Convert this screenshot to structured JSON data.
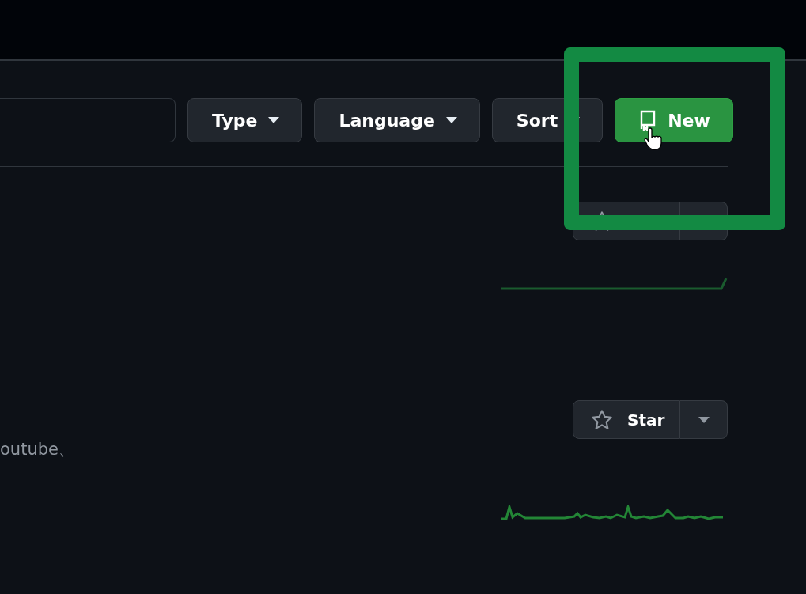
{
  "toolbar": {
    "filters": [
      {
        "label": "Type"
      },
      {
        "label": "Language"
      },
      {
        "label": "Sort"
      }
    ],
    "new_button": {
      "label": "New"
    }
  },
  "repositories": [
    {
      "kind": "quiet"
    },
    {
      "kind": "active",
      "description": "outube、",
      "star_button": {
        "label": "Star"
      }
    }
  ]
}
